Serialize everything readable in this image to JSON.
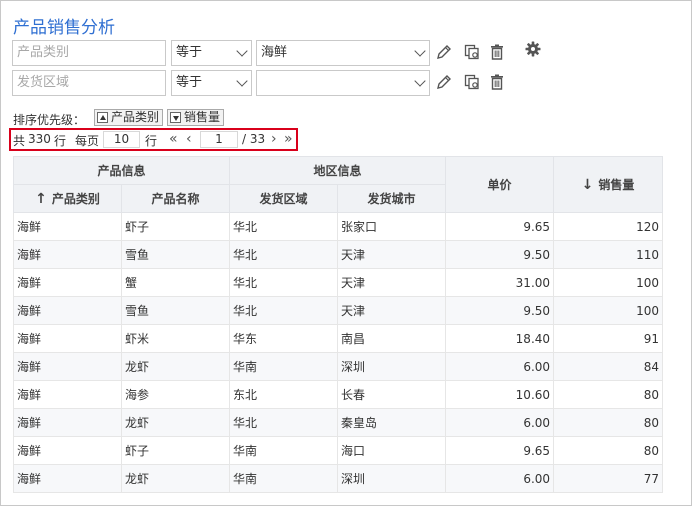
{
  "title": "产品销售分析",
  "filters": [
    {
      "field_placeholder": "产品类别",
      "operator": "等于",
      "value": "海鲜"
    },
    {
      "field_placeholder": "发货区域",
      "operator": "等于",
      "value": ""
    }
  ],
  "icons": {
    "edit": "pencil-icon",
    "copy": "copy-settings-icon",
    "delete": "trash-icon",
    "settings": "gear-icon"
  },
  "sort": {
    "label": "排序优先级：",
    "buttons": [
      {
        "label": "产品类别",
        "direction": "up"
      },
      {
        "label": "销售量",
        "direction": "down"
      }
    ]
  },
  "pager": {
    "total_prefix": "共",
    "total": "330",
    "total_suffix": "行",
    "per_page_label": "每页",
    "per_page": "10",
    "per_page_suffix": "行",
    "first": "«",
    "prev": "‹",
    "current_page": "1",
    "total_pages": "/ 33",
    "next": "›",
    "last": "»"
  },
  "table": {
    "groups": [
      {
        "label": "产品信息"
      },
      {
        "label": "地区信息"
      }
    ],
    "columns": {
      "category": "产品类别",
      "name": "产品名称",
      "region": "发货区域",
      "city": "发货城市",
      "price": "单价",
      "qty": "销售量"
    },
    "sort_arrows": {
      "up": "↑",
      "down": "↓"
    },
    "rows": [
      [
        "海鲜",
        "虾子",
        "华北",
        "张家口",
        "9.65",
        "120"
      ],
      [
        "海鲜",
        "雪鱼",
        "华北",
        "天津",
        "9.50",
        "110"
      ],
      [
        "海鲜",
        "蟹",
        "华北",
        "天津",
        "31.00",
        "100"
      ],
      [
        "海鲜",
        "雪鱼",
        "华北",
        "天津",
        "9.50",
        "100"
      ],
      [
        "海鲜",
        "虾米",
        "华东",
        "南昌",
        "18.40",
        "91"
      ],
      [
        "海鲜",
        "龙虾",
        "华南",
        "深圳",
        "6.00",
        "84"
      ],
      [
        "海鲜",
        "海参",
        "东北",
        "长春",
        "10.60",
        "80"
      ],
      [
        "海鲜",
        "龙虾",
        "华北",
        "秦皇岛",
        "6.00",
        "80"
      ],
      [
        "海鲜",
        "虾子",
        "华南",
        "海口",
        "9.65",
        "80"
      ],
      [
        "海鲜",
        "龙虾",
        "华南",
        "深圳",
        "6.00",
        "77"
      ]
    ]
  }
}
